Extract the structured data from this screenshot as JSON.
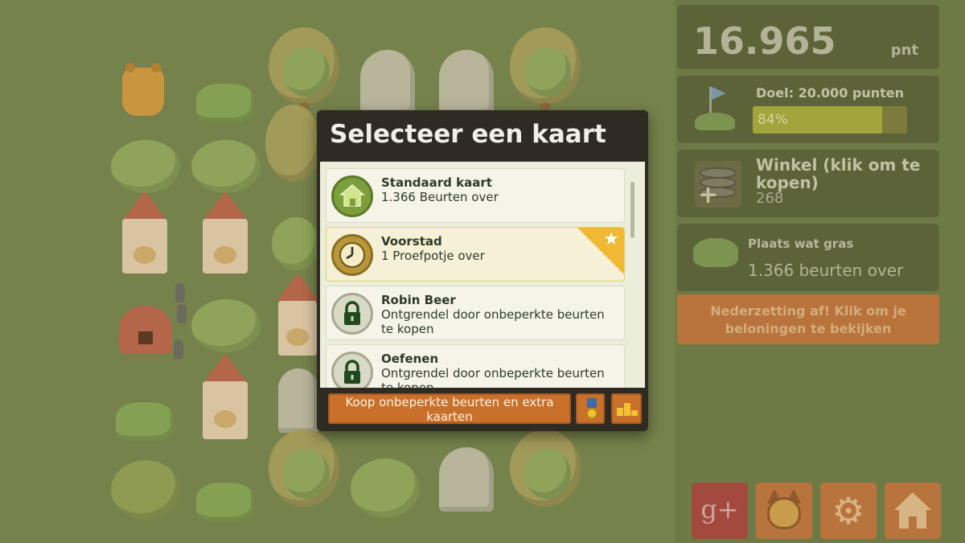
{
  "hud": {
    "score": {
      "value": "16.965",
      "unit": "pnt"
    },
    "goal": {
      "label": "Doel: 20.000 punten",
      "progress_text": "84%",
      "progress": 0.84
    },
    "shop": {
      "label": "Winkel (klik om te kopen)",
      "count": "268"
    },
    "placement": {
      "label": "Plaats wat gras",
      "turns": "1.366 beurten over"
    },
    "settlement_banner": "Nederzetting af! Klik om je beloningen te bekijken"
  },
  "modal": {
    "title": "Selecteer een kaart",
    "cards": [
      {
        "title": "Standaard kaart",
        "subtitle": "1.366 Beurten over",
        "icon": "house-icon",
        "locked": false
      },
      {
        "title": "Voorstad",
        "subtitle": "1 Proefpotje over",
        "icon": "clock-icon",
        "locked": false,
        "featured": true
      },
      {
        "title": "Robin Beer",
        "subtitle": "Ontgrendel door onbeperkte beurten te kopen",
        "icon": "lock-icon",
        "locked": true
      },
      {
        "title": "Oefenen",
        "subtitle": "Ontgrendel door onbeperkte beurten te kopen",
        "icon": "lock-icon",
        "locked": true
      }
    ],
    "buy_button": "Koop onbeperkte beurten en extra kaarten"
  },
  "corner_buttons": {
    "google_plus": "g+"
  },
  "colors": {
    "board": "#76824b",
    "panel": "#5c6338",
    "orange_button": "#c9702b",
    "modal_bg": "#2f2b23",
    "ribbon": "#f0b833"
  }
}
